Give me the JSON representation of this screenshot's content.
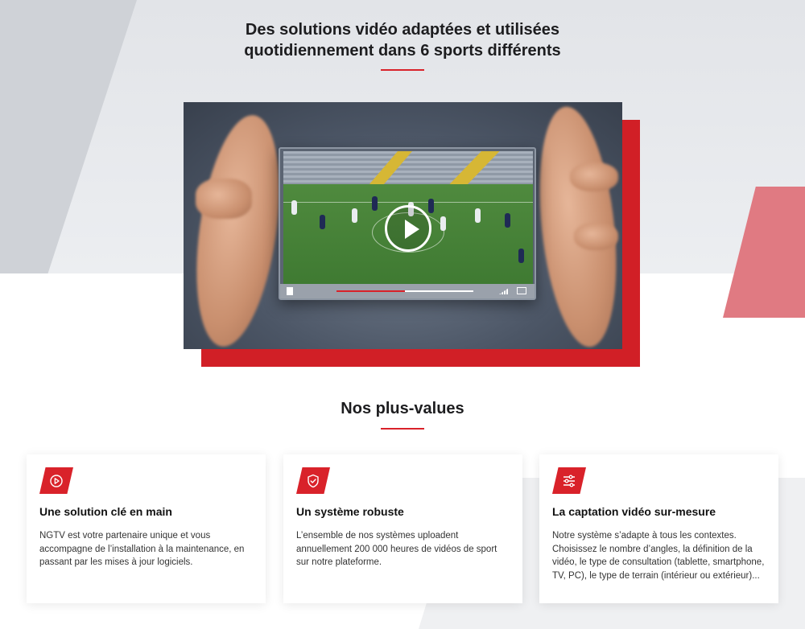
{
  "hero": {
    "title_line1": "Des solutions vidéo adaptées et utilisées",
    "title_line2": "quotidiennement dans 6 sports différents"
  },
  "video": {
    "play_icon": "play-icon",
    "progress": 0.5
  },
  "values": {
    "title": "Nos plus-values",
    "cards": [
      {
        "icon": "play-circle-icon",
        "title": "Une solution clé en main",
        "text": "NGTV est votre partenaire unique et vous accompagne de l’installation à la maintenance, en passant par les mises à jour logiciels."
      },
      {
        "icon": "shield-check-icon",
        "title": "Un système robuste",
        "text": "L’ensemble de nos systèmes uploadent annuellement 200 000 heures de vidéos de sport sur notre plateforme."
      },
      {
        "icon": "sliders-icon",
        "title": "La captation vidéo sur-mesure",
        "text": "Notre système s’adapte à tous les contextes. Choisissez le nombre d’angles, la définition de la vidéo, le type de consultation (tablette, smartphone, TV, PC), le type de terrain (intérieur ou extérieur)..."
      }
    ]
  },
  "colors": {
    "accent": "#d9222a",
    "background_top": "#e2e4e8"
  }
}
